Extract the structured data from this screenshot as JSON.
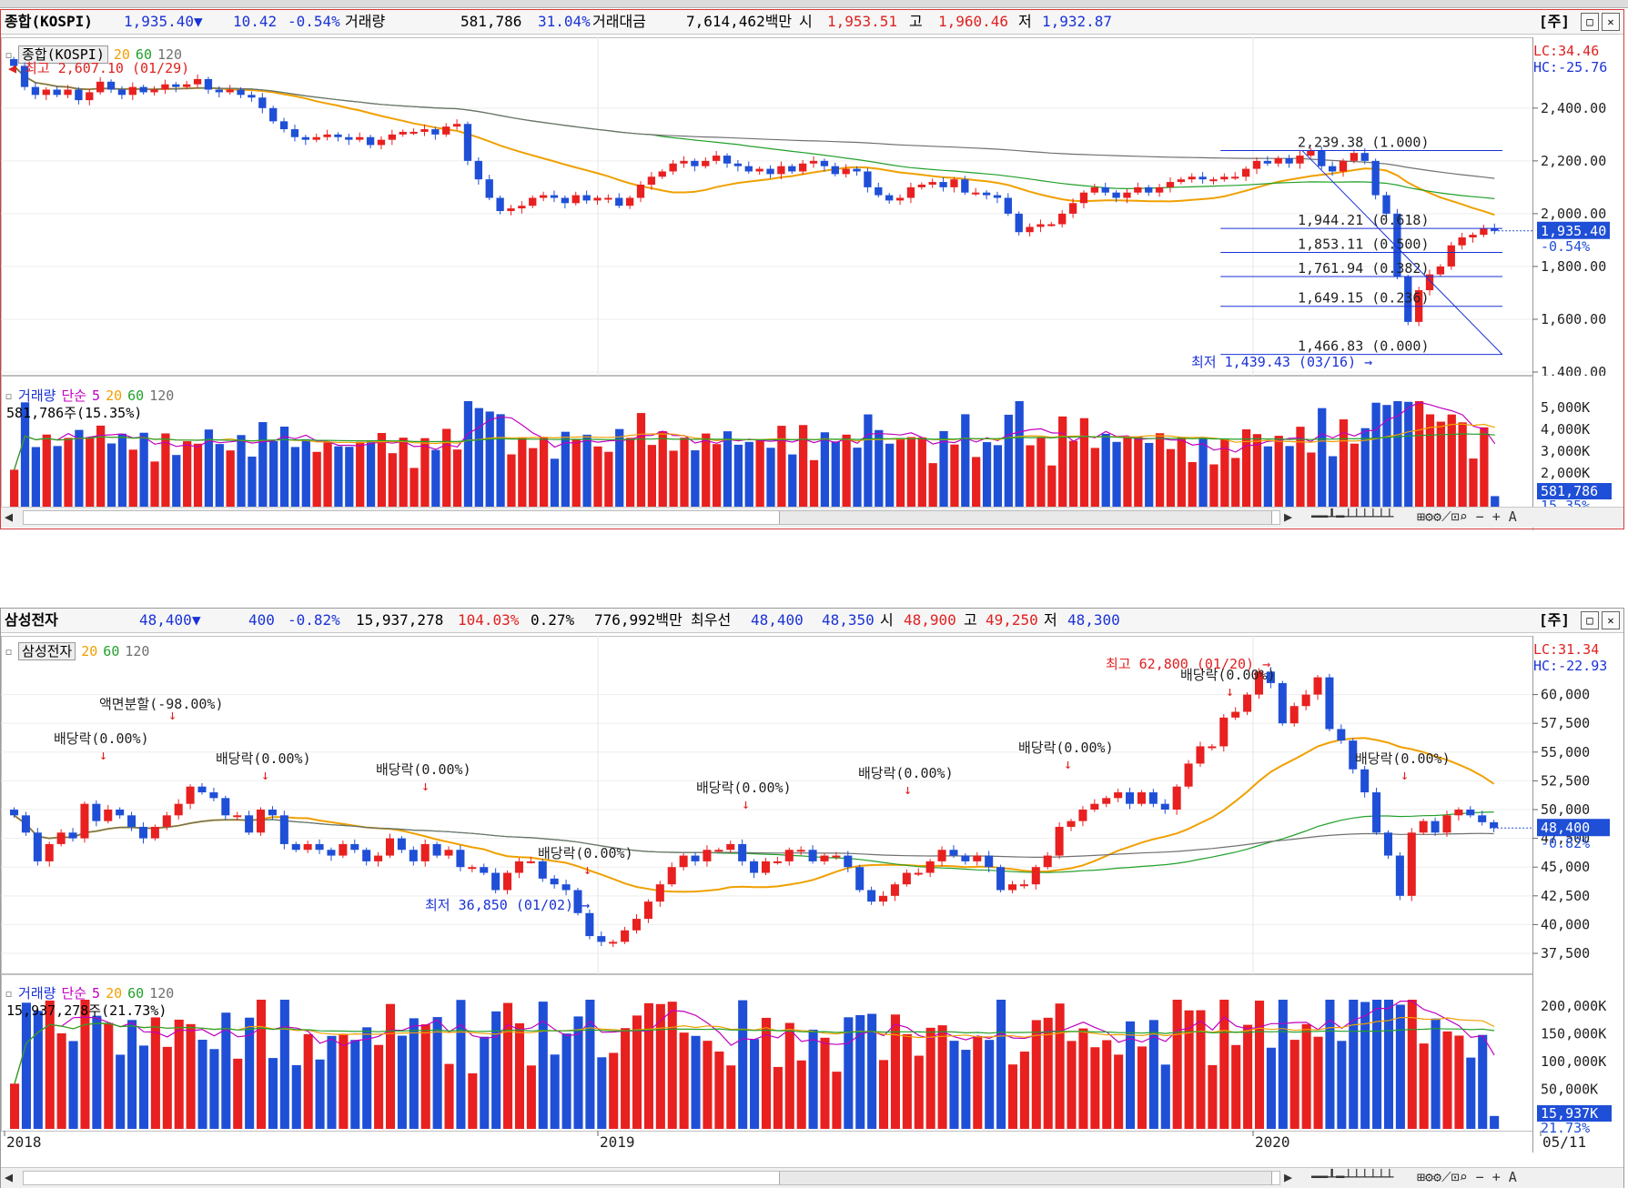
{
  "panels": [
    {
      "id": "kospi",
      "name": "종합(KOSPI)",
      "price": "1,935.40",
      "change_arrow": "▼",
      "change": "10.42",
      "change_pct": "-0.54%",
      "vol_label": "거래량",
      "volume": "581,786",
      "vol_ratio": "31.04%",
      "amount_label": "거래대금",
      "amount": "7,614,462백만",
      "open_label": "시",
      "open": "1,953.51",
      "high_label": "고",
      "high": "1,960.46",
      "low_label": "저",
      "low": "1,932.87",
      "period_tag": "[주]",
      "legend_name": "종합(KOSPI)",
      "ma_labels": [
        "20",
        "60",
        "120"
      ],
      "lc": "LC:34.46",
      "hc": "HC:-25.76",
      "price_tag": "1,935.40",
      "price_tag_pct": "-0.54%",
      "max_note": "최고 2,607.10 (01/29)",
      "min_note": "최저 1,439.43 (03/16)",
      "fib": [
        "2,239.38 (1.000)",
        "1,944.21 (0.618)",
        "1,853.11 (0.500)",
        "1,761.94 (0.382)",
        "1,649.15 (0.236)",
        "1,466.83 (0.000)"
      ],
      "vol_legend": {
        "label": "거래량",
        "type": "단순",
        "ma": [
          "5",
          "20",
          "60",
          "120"
        ],
        "value": "581,786주(15.35%)"
      },
      "vol_tag": "581,786",
      "vol_tag_pct": "15.35%",
      "x_labels": [
        "2018",
        "2019",
        "2020",
        "05/11"
      ]
    },
    {
      "id": "samsung",
      "name": "삼성전자",
      "price": "48,400",
      "change_arrow": "▼",
      "change": "400",
      "change_pct": "-0.82%",
      "volume": "15,937,278",
      "vol_ratio": "104.03%",
      "turnover": "0.27%",
      "amount": "776,992백만",
      "pref_label": "최우선",
      "pref_ask": "48,400",
      "pref_bid": "48,350",
      "open_label": "시",
      "open": "48,900",
      "high_label": "고",
      "high": "49,250",
      "low_label": "저",
      "low": "48,300",
      "period_tag": "[주]",
      "legend_name": "삼성전자",
      "ma_labels": [
        "20",
        "60",
        "120"
      ],
      "lc": "LC:31.34",
      "hc": "HC:-22.93",
      "price_tag": "48,400",
      "price_tag_pct": "-0.82%",
      "max_note": "최고 62,800 (01/20)",
      "min_note": "최저 36,850 (01/02)",
      "split_note": "액면분할(-98.00%)",
      "dividend_note": "배당락(0.00%)",
      "vol_legend": {
        "label": "거래량",
        "type": "단순",
        "ma": [
          "5",
          "20",
          "60",
          "120"
        ],
        "value": "15,937,278주(21.73%)"
      },
      "vol_tag": "15,937K",
      "vol_tag_pct": "21.73%",
      "x_labels": [
        "2018",
        "2019",
        "2020",
        "05/11"
      ]
    }
  ],
  "chart_data": [
    {
      "type": "candlestick",
      "title": "종합(KOSPI)",
      "y_ticks": [
        "2,400.00",
        "2,200.00",
        "2,000.00",
        "1,800.00",
        "1,600.00",
        "1,400.00"
      ],
      "ylim": [
        1400,
        2620
      ],
      "close_weekly": [
        2560,
        2480,
        2450,
        2470,
        2450,
        2470,
        2430,
        2460,
        2500,
        2470,
        2450,
        2480,
        2460,
        2470,
        2490,
        2480,
        2490,
        2510,
        2470,
        2460,
        2470,
        2450,
        2440,
        2400,
        2350,
        2320,
        2290,
        2280,
        2290,
        2300,
        2290,
        2280,
        2290,
        2260,
        2280,
        2300,
        2310,
        2310,
        2320,
        2300,
        2330,
        2340,
        2200,
        2130,
        2060,
        2010,
        2020,
        2030,
        2060,
        2070,
        2060,
        2040,
        2070,
        2050,
        2060,
        2060,
        2030,
        2060,
        2110,
        2140,
        2160,
        2190,
        2200,
        2180,
        2200,
        2220,
        2190,
        2180,
        2160,
        2170,
        2150,
        2180,
        2160,
        2190,
        2200,
        2180,
        2150,
        2170,
        2160,
        2100,
        2070,
        2050,
        2060,
        2100,
        2110,
        2120,
        2100,
        2130,
        2080,
        2080,
        2070,
        2060,
        2000,
        1930,
        1950,
        1960,
        1960,
        2000,
        2040,
        2080,
        2100,
        2080,
        2060,
        2080,
        2100,
        2080,
        2100,
        2120,
        2130,
        2140,
        2130,
        2130,
        2140,
        2140,
        2170,
        2200,
        2190,
        2210,
        2190,
        2220,
        2240,
        2180,
        2160,
        2200,
        2230,
        2200,
        2070,
        2000,
        1760,
        1590,
        1710,
        1770,
        1800,
        1880,
        1910,
        1920,
        1945,
        1935
      ],
      "ma_20_color": "#f0a000",
      "ma_60_color": "#22a02a",
      "ma_120_color": "#707070"
    },
    {
      "type": "candlestick",
      "title": "삼성전자",
      "y_ticks": [
        "60,000",
        "57,500",
        "55,000",
        "52,500",
        "50,000",
        "47,500",
        "45,000",
        "42,500",
        "40,000",
        "37,500"
      ],
      "ylim": [
        36000,
        64000
      ],
      "close_weekly": [
        49500,
        48000,
        45500,
        47000,
        48000,
        47500,
        50500,
        49000,
        50000,
        49500,
        48500,
        47500,
        48500,
        49500,
        50500,
        52000,
        51500,
        51000,
        49500,
        49500,
        48000,
        50000,
        49500,
        47000,
        46500,
        47000,
        46500,
        46000,
        47000,
        46500,
        45500,
        46000,
        47500,
        46500,
        45500,
        47000,
        46000,
        46500,
        45000,
        45000,
        44500,
        43000,
        44500,
        45500,
        45500,
        44000,
        43500,
        43000,
        41000,
        39000,
        38500,
        38500,
        39500,
        40500,
        42000,
        43500,
        45000,
        46000,
        45500,
        46500,
        46500,
        47000,
        45500,
        44500,
        45500,
        45500,
        46500,
        46500,
        45500,
        46000,
        46000,
        45000,
        43000,
        42000,
        42500,
        43500,
        44500,
        44500,
        45500,
        46500,
        46000,
        45500,
        46000,
        45000,
        43000,
        43500,
        43500,
        45000,
        46000,
        48500,
        49000,
        50000,
        50500,
        51000,
        51500,
        50500,
        51500,
        50500,
        50000,
        52000,
        54000,
        55500,
        55500,
        58000,
        58500,
        60000,
        62000,
        61000,
        57500,
        59000,
        60000,
        61500,
        57000,
        56000,
        53500,
        51500,
        48000,
        46000,
        42500,
        48000,
        49000,
        48000,
        49500,
        50000,
        49500,
        48900,
        48400
      ]
    }
  ]
}
